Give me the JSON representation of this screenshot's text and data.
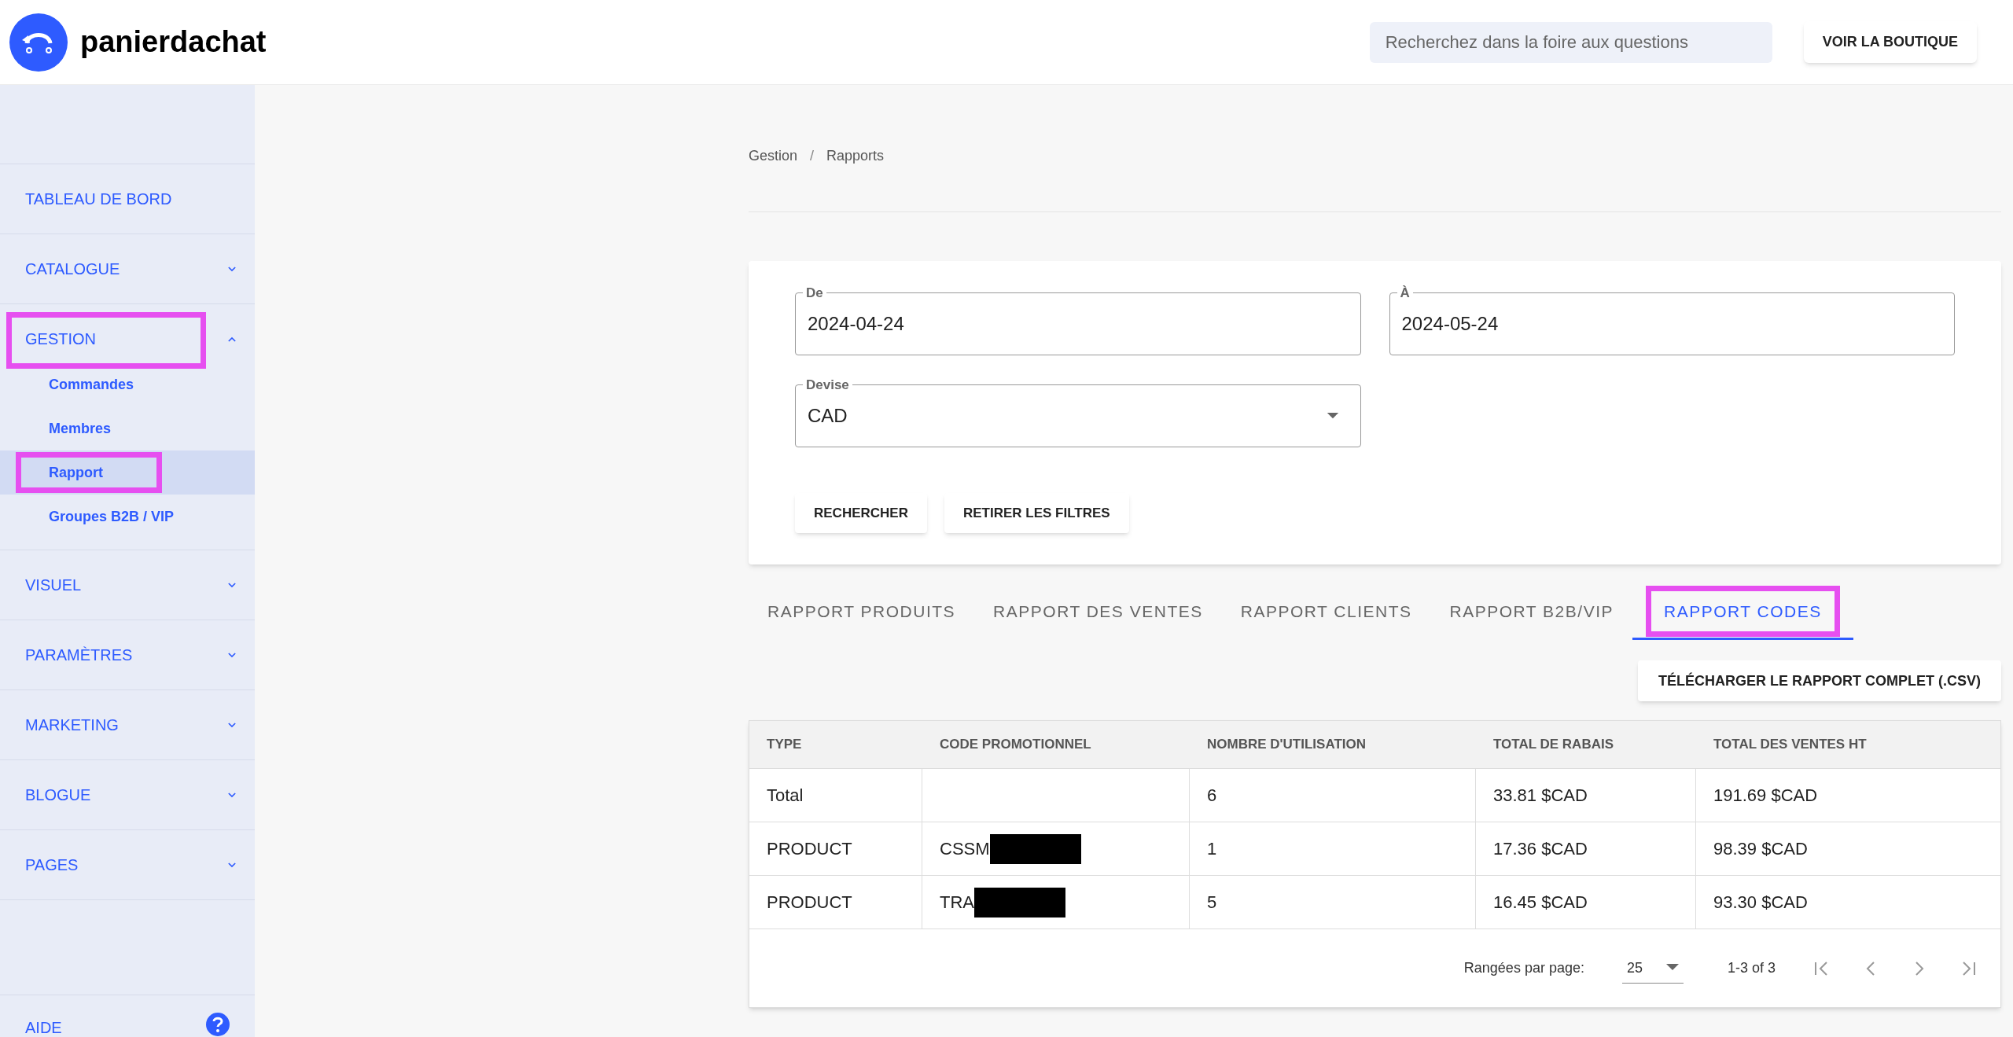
{
  "header": {
    "brand": "panierdachat",
    "search": {
      "placeholder": "Recherchez dans la foire aux questions"
    },
    "shop_button": "VOIR LA BOUTIQUE"
  },
  "sidebar": {
    "items": [
      {
        "label": "TABLEAU DE BORD",
        "highlighted": false
      },
      {
        "label": "CATALOGUE",
        "expanded": false,
        "highlighted": false
      },
      {
        "label": "GESTION",
        "expanded": true,
        "highlighted": true,
        "children": [
          {
            "label": "Commandes",
            "selected": false,
            "highlighted": false
          },
          {
            "label": "Membres",
            "selected": false,
            "highlighted": false
          },
          {
            "label": "Rapport",
            "selected": true,
            "highlighted": true
          },
          {
            "label": "Groupes B2B / VIP",
            "selected": false,
            "highlighted": false
          }
        ]
      },
      {
        "label": "VISUEL",
        "expanded": false,
        "highlighted": false
      },
      {
        "label": "PARAMÈTRES",
        "expanded": false,
        "highlighted": false
      },
      {
        "label": "MARKETING",
        "expanded": false,
        "highlighted": false
      },
      {
        "label": "BLOGUE",
        "expanded": false,
        "highlighted": false
      },
      {
        "label": "PAGES",
        "expanded": false,
        "highlighted": false
      }
    ],
    "help": "AIDE"
  },
  "breadcrumb": [
    "Gestion",
    "/",
    "Rapports"
  ],
  "filters": {
    "from": {
      "label": "De",
      "value": "2024-04-24"
    },
    "to": {
      "label": "À",
      "value": "2024-05-24"
    },
    "currency": {
      "label": "Devise",
      "value": "CAD"
    },
    "buttons": [
      "RECHERCHER",
      "RETIRER LES FILTRES"
    ]
  },
  "tabs": [
    {
      "label": "RAPPORT PRODUITS",
      "selected": false,
      "highlighted": false
    },
    {
      "label": "RAPPORT DES VENTES",
      "selected": false,
      "highlighted": false
    },
    {
      "label": "RAPPORT CLIENTS",
      "selected": false,
      "highlighted": false
    },
    {
      "label": "RAPPORT B2B/VIP",
      "selected": false,
      "highlighted": false
    },
    {
      "label": "RAPPORT CODES",
      "selected": true,
      "highlighted": true
    }
  ],
  "download_button": "TÉLÉCHARGER LE RAPPORT COMPLET (.CSV)",
  "table": {
    "columns": [
      "TYPE",
      "CODE PROMOTIONNEL",
      "NOMBRE D'UTILISATION",
      "TOTAL DE RABAIS",
      "TOTAL DES VENTES HT"
    ],
    "rows": [
      {
        "type": "Total",
        "uses": "6",
        "discount": "33.81 $CAD",
        "sales": "191.69 $CAD"
      },
      {
        "type": "PRODUCT",
        "code": "CSSM",
        "redacted": true,
        "uses": "1",
        "discount": "17.36 $CAD",
        "sales": "98.39 $CAD"
      },
      {
        "type": "PRODUCT",
        "code": "TRA",
        "redacted": true,
        "uses": "5",
        "discount": "16.45 $CAD",
        "sales": "93.30 $CAD"
      }
    ],
    "pagination": {
      "rows_label": "Rangées par page:",
      "rows_value": "25",
      "range": "1-3 of 3"
    }
  }
}
